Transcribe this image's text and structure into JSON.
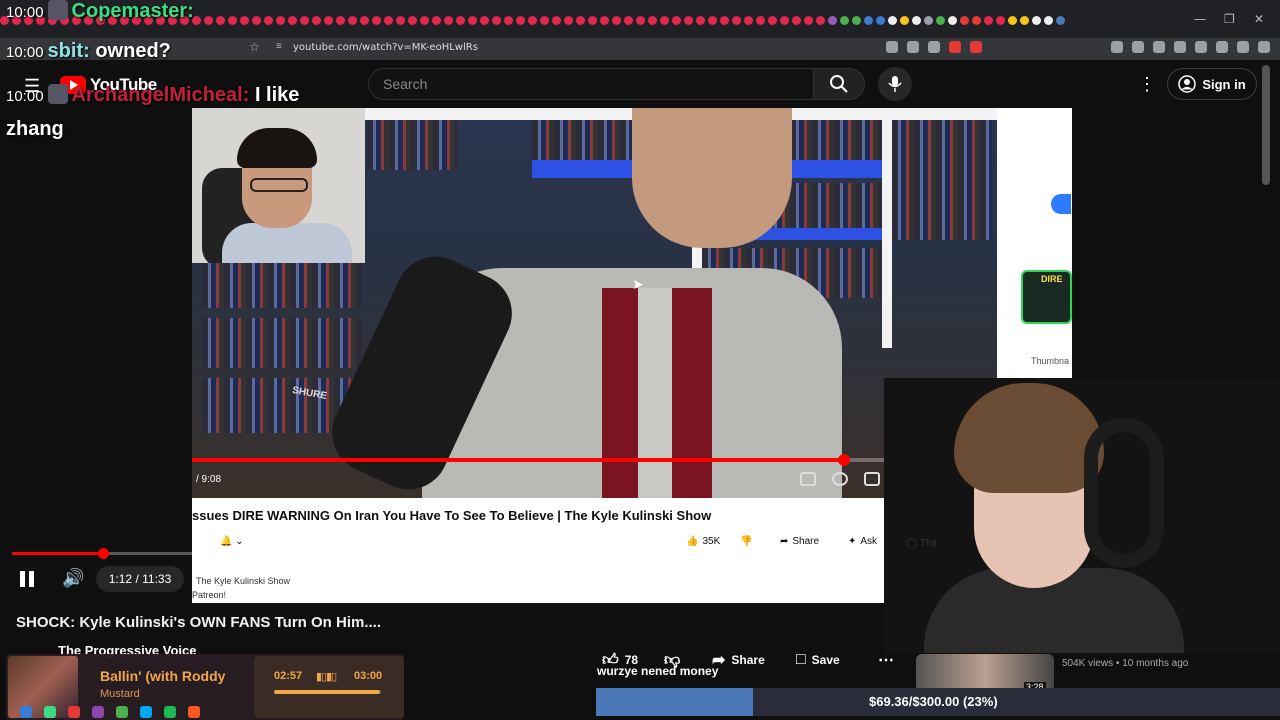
{
  "browser": {
    "url": "youtube.com/watch?v=MK-eoHLwlRs"
  },
  "chat": [
    {
      "time": "10:00",
      "user": "Copemaster:",
      "message": ""
    },
    {
      "time": "10:00",
      "user": "sbit:",
      "message": "owned?"
    },
    {
      "time": "10:00",
      "user": "ArchangelMicheal:",
      "message": "I like"
    },
    {
      "continuation": "zhang"
    }
  ],
  "youtube_header": {
    "logo_text": "YouTube",
    "search_placeholder": "Search",
    "sign_in_label": "Sign in"
  },
  "inner_video": {
    "time_display": "/ 9:08",
    "title": "ssues DIRE WARNING On Iran You Have To See To Believe | The Kyle Kulinski Show",
    "like_count": "35K",
    "share_label": "Share",
    "ask_label": "Ask",
    "thanks_label": "Tha",
    "channel": "The Kyle Kulinski Show",
    "patreon": "Patreon!",
    "progress_fraction": 0.81,
    "mic_brand": "SHURE"
  },
  "right_panel": {
    "thumb_label": "Thumbna",
    "thumb_text": "DIRE"
  },
  "player": {
    "time": "1:12 / 11:33",
    "progress_fraction": 0.104
  },
  "video": {
    "title": "SHOCK: Kyle Kulinski's OWN FANS Turn On Him....",
    "channel": "The Progressive Voice",
    "like_count": "78",
    "share_label": "Share",
    "save_label": "Save"
  },
  "music": {
    "song": "Ballin' (with Roddy",
    "artist": "Mustard",
    "current": "02:57",
    "duration": "03:00",
    "progress_fraction": 0.98
  },
  "donation": {
    "caption": "wurzye nened money",
    "text": "$69.36/$300.00 (23%)",
    "fraction": 0.23
  },
  "related": {
    "meta": "504K views • 10 months ago",
    "duration": "3:28"
  },
  "colors": {
    "youtube_red": "#ff0000",
    "chat_green": "#3ddc84",
    "chat_cyan": "#8fe3e8",
    "chat_red": "#c0203a",
    "music_accent": "#f2a64a",
    "goal_fill": "#4a78b8"
  },
  "icons": {
    "menu": "hamburger-icon",
    "search": "search-icon",
    "mic": "microphone-icon",
    "more": "kebab-icon",
    "account": "account-circle-icon",
    "like": "thumbs-up-icon",
    "dislike": "thumbs-down-icon",
    "share": "share-arrow-icon",
    "save": "bookmark-icon",
    "pause": "pause-icon",
    "volume": "volume-icon"
  }
}
